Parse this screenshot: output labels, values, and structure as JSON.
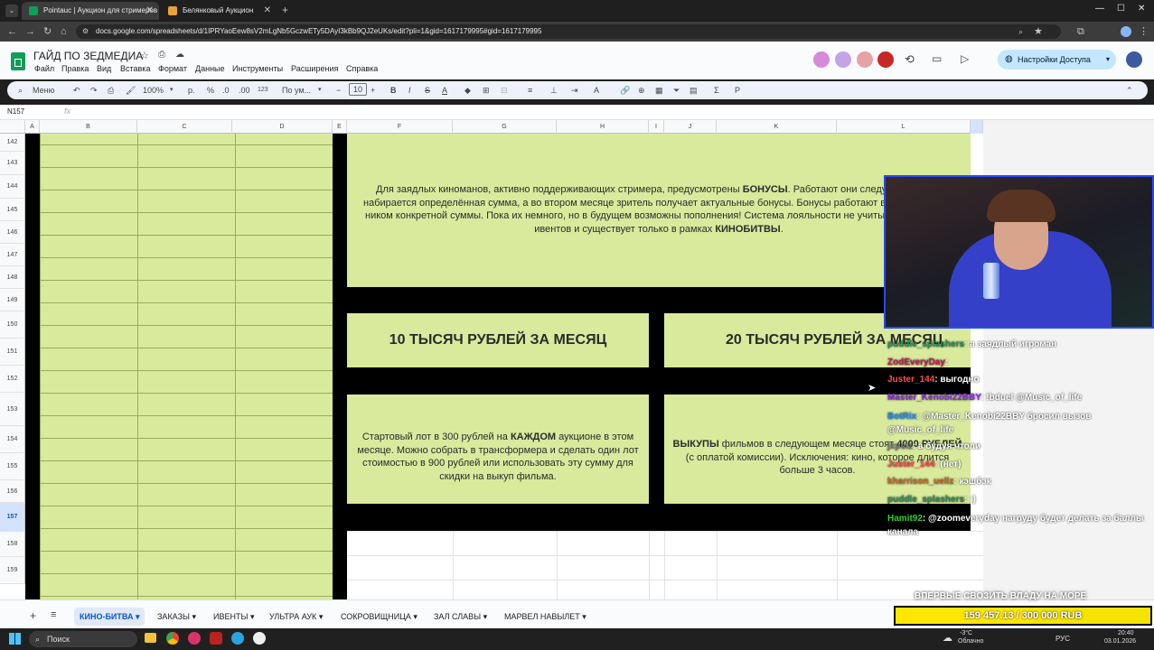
{
  "browser": {
    "tabs": [
      {
        "title": "Pointauc | Аукцион для стримеров",
        "active": true
      },
      {
        "title": "Белянковый Аукцион",
        "active": false
      }
    ],
    "url": "docs.google.com/spreadsheets/d/1IPRYaoEew8sV2mLgNb5GczwETy5DAyI3kBb9QJ2eUKs/edit?pli=1&gid=1617179995#gid=1617179995"
  },
  "doc": {
    "title": "ГАЙД ПО ЗЕДМЕДИА",
    "menu": [
      "Файл",
      "Правка",
      "Вид",
      "Вставка",
      "Формат",
      "Данные",
      "Инструменты",
      "Расширения",
      "Справка"
    ],
    "share_label": "Настройки Доступа"
  },
  "toolbar": {
    "menu_label": "Меню",
    "zoom": "100%",
    "currency": "р.",
    "percent": "%",
    "dec_less": ".0",
    "dec_more": ".00",
    "number_format": "123",
    "font": "По ум...",
    "font_size": "10"
  },
  "formula_bar": {
    "cell_ref": "N157",
    "fx": "fx"
  },
  "columns": [
    "A",
    "B",
    "C",
    "D",
    "E",
    "F",
    "G",
    "H",
    "I",
    "J",
    "K",
    "L"
  ],
  "rows": [
    "142",
    "143",
    "144",
    "145",
    "146",
    "147",
    "148",
    "149",
    "150",
    "151",
    "152",
    "153",
    "154",
    "155",
    "156",
    "157",
    "158",
    "159"
  ],
  "selected_row": "157",
  "content": {
    "bonus_text_1": "Для заядлых киноманов, активно поддерживающих стримера, предусмотрены ",
    "bonus_bold_1": "БОНУСЫ",
    "bonus_text_2": ". Работают они следующим образом: за",
    "bonus_line_2": "набирается определённая сумма, а во втором месяце зритель получает актуальные бонусы. Бонусы работают в случае донатов з",
    "bonus_line_3": "ником конкретной суммы. Пока их немного, но в будущем возможны пополнения! Система лояльности не учитывает выкупы сер",
    "bonus_line_4a": "ивентов и существует только в рамках ",
    "bonus_bold_2": "КИНОБИТВЫ",
    "bonus_line_4b": ".",
    "tier1_title": "10 ТЫСЯЧ РУБЛЕЙ ЗА МЕСЯЦ",
    "tier2_title": "20 ТЫСЯЧ РУБЛЕЙ ЗА МЕСЯЦ",
    "tier1_text_a": "Стартовый лот в 300 рублей на ",
    "tier1_bold": "КАЖДОМ",
    "tier1_text_b": " аукционе в этом месяце. Можно собрать в трансформера и сделать один лот стоимостью в 900 рублей или использовать эту сумму для скидки на выкуп фильма.",
    "tier2_bold_a": "ВЫКУПЫ",
    "tier2_text_a": " фильмов в следующем месяце стоят ",
    "tier2_bold_b": "4000 РУБЛЕЙ",
    "tier2_text_b": " (с оплатой комиссии). Исключения: кино, которое длится больше 3 часов."
  },
  "sheet_tabs": [
    "КИНО-БИТВА",
    "ЗАКАЗЫ",
    "ИВЕНТЫ",
    "УЛЬТРА АУК",
    "СОКРОВИЩНИЦА",
    "ЗАЛ СЛАВЫ",
    "МАРВЕЛ НАВЫЛЕТ"
  ],
  "active_sheet": "КИНО-БИТВА",
  "chat": [
    {
      "user": "puddle_splashers",
      "color": "#2e8b57",
      "msg": ": а заядлый игроман"
    },
    {
      "user": "ZodEveryDay",
      "color": "#c2185b",
      "msg": ":"
    },
    {
      "user": "Juster_144",
      "color": "#ff4b4b",
      "msg": ": выгодно"
    },
    {
      "user": "Master_Kenobi22BBY",
      "color": "#8a2be2",
      "msg": ": !bduel @Music_of_life"
    },
    {
      "user": "BotRix",
      "color": "#1e90ff",
      "msg": ": @Master_Kenobi22BBY бросил вызов @Music_of_life"
    },
    {
      "user": "jxpsiz",
      "color": "#7a7a7a",
      "msg": ": а будуя чтоли"
    },
    {
      "user": "Juster_144",
      "color": "#ff4b4b",
      "msg": ": (нет)"
    },
    {
      "user": "kharrison_uellz",
      "color": "#d2691e",
      "msg": ": кэшбэк"
    },
    {
      "user": "puddle_splashers",
      "color": "#2e8b57",
      "msg": ": :)"
    },
    {
      "user": "Hamit92",
      "color": "#32cd32",
      "msg": ": @zoomeverуday нагруду будет делать за баллы канала"
    }
  ],
  "donation": {
    "title": "ВПЕРВЫЕ СВОЗИТЬ ВЛАДУ НА МОРЕ",
    "progress_text": "159 457.13 / 300 000 RUB",
    "progress_fraction": 0.5315
  },
  "taskbar": {
    "search": "Поиск",
    "weather_temp": "-3°C",
    "weather_desc": "Облачно",
    "lang": "РУС",
    "time": "20:40",
    "date": "03.01.2026"
  }
}
